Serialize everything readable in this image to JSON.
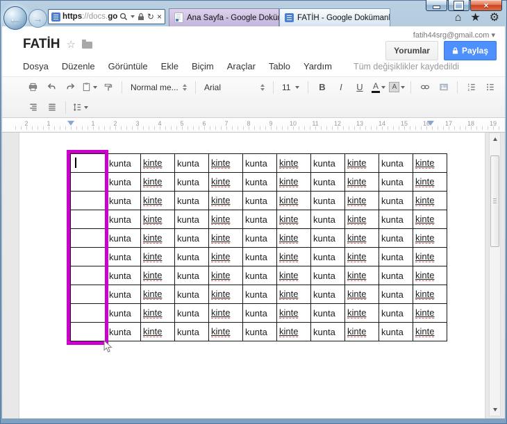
{
  "window": {
    "controls": {
      "minimize_label": "minimize",
      "maximize_label": "maximize",
      "close_glyph": "×"
    }
  },
  "browser": {
    "back_glyph": "←",
    "forward_glyph": "→",
    "address": {
      "url_scheme": "https",
      "url_host_gray": "://docs.",
      "url_host_dark": "goo...",
      "refresh_glyph": "↻",
      "close_glyph": "×"
    },
    "tabs": [
      {
        "label": "Ana Sayfa - Google Dokümanlar"
      },
      {
        "label": "FATİH - Google Dokümanlar",
        "close_glyph": "×"
      }
    ],
    "action_icons": {
      "home": "⌂",
      "favorites": "★",
      "settings": "⚙"
    }
  },
  "docs": {
    "account_email": "fatih44srg@gmail.com",
    "account_caret": "▾",
    "title": "FATİH",
    "star_glyph": "☆",
    "menus": [
      "Dosya",
      "Düzenle",
      "Görüntüle",
      "Ekle",
      "Biçim",
      "Araçlar",
      "Tablo",
      "Yardım"
    ],
    "save_status": "Tüm değişiklikler kaydedildi",
    "comments_label": "Yorumlar",
    "share_label": "Paylaş",
    "toolbar": {
      "style_value": "Normal me...",
      "font_value": "Arial",
      "font_size_value": "11",
      "bold": "B",
      "italic": "I",
      "underline": "U",
      "text_color": "A",
      "highlight": "A"
    },
    "ruler": {
      "labels": [
        "2",
        "1",
        "1",
        "2",
        "3",
        "4",
        "5",
        "6",
        "7",
        "8",
        "9",
        "10",
        "11",
        "12",
        "13",
        "14",
        "15",
        "16",
        "17",
        "18",
        "19"
      ]
    },
    "table": {
      "row_count": 10,
      "columns": [
        {
          "text": "",
          "selected": true
        },
        {
          "text": "kunta"
        },
        {
          "text": "kinte",
          "misspelled": true
        },
        {
          "text": "kunta"
        },
        {
          "text": "kinte",
          "misspelled": true
        },
        {
          "text": "kunta"
        },
        {
          "text": "kinte",
          "misspelled": true
        },
        {
          "text": "kunta"
        },
        {
          "text": "kinte",
          "misspelled": true
        },
        {
          "text": "kunta"
        },
        {
          "text": "kinte",
          "misspelled": true
        }
      ]
    },
    "colors": {
      "share_button_blue": "#4d90fe",
      "column_selection_magenta": "#cc00cc",
      "spellcheck_red": "#e06060"
    }
  }
}
